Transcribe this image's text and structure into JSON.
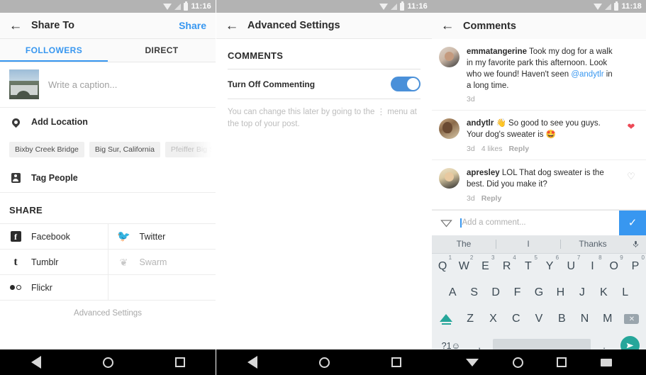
{
  "screen1": {
    "statusbar": {
      "time": "11:16",
      "icons": [
        "wifi-icon",
        "signal-icon",
        "battery-icon"
      ]
    },
    "appbar": {
      "back": "back-arrow-icon",
      "title": "Share To",
      "action": "Share"
    },
    "tabs": [
      {
        "label": "FOLLOWERS",
        "active": true
      },
      {
        "label": "DIRECT",
        "active": false
      }
    ],
    "caption": {
      "placeholder": "Write a caption...",
      "thumbnail": "post-thumbnail"
    },
    "add_location": {
      "label": "Add Location",
      "icon": "location-pin-icon"
    },
    "location_chips": [
      {
        "label": "Bixby Creek Bridge",
        "faded": false
      },
      {
        "label": "Big Sur, California",
        "faded": false
      },
      {
        "label": "Pfeiffer Big Sur State Par",
        "faded": true
      }
    ],
    "tag_people": {
      "label": "Tag People",
      "icon": "tag-people-icon"
    },
    "share_section": {
      "heading": "SHARE",
      "items": [
        {
          "label": "Facebook",
          "icon": "facebook-icon",
          "dim": false
        },
        {
          "label": "Twitter",
          "icon": "twitter-icon",
          "dim": false
        },
        {
          "label": "Tumblr",
          "icon": "tumblr-icon",
          "dim": false
        },
        {
          "label": "Swarm",
          "icon": "swarm-icon",
          "dim": true
        },
        {
          "label": "Flickr",
          "icon": "flickr-icon",
          "dim": false
        }
      ]
    },
    "advanced_settings_link": "Advanced Settings",
    "navbar": {
      "back": "nav-back-icon",
      "home": "nav-home-icon",
      "recent": "nav-recent-icon"
    },
    "colors": {
      "accent": "#3897f0",
      "appbar_bg": "#fafafa",
      "statusbar_bg": "#b3b3b3"
    }
  },
  "screen2": {
    "statusbar": {
      "time": "11:16"
    },
    "appbar": {
      "back": "back-arrow-icon",
      "title": "Advanced Settings"
    },
    "section_heading": "COMMENTS",
    "toggle": {
      "label": "Turn Off Commenting",
      "on": true,
      "color": "#4a90d9"
    },
    "hint_part1": "You can change this later by going to the",
    "hint_dots": "⋮",
    "hint_part2": "menu at the top of your post.",
    "navbar": {
      "back": "nav-back-icon",
      "home": "nav-home-icon",
      "recent": "nav-recent-icon"
    }
  },
  "screen3": {
    "statusbar": {
      "time": "11:18"
    },
    "appbar": {
      "back": "back-arrow-icon",
      "title": "Comments"
    },
    "comments": [
      {
        "avatar": "avatar-emmatangerine",
        "username": "emmatangerine",
        "text_before": " Took my dog for a walk in my favorite park this afternoon. Look who we found! Haven't seen ",
        "mention": "@andytlr",
        "text_after": " in a long time.",
        "time": "3d",
        "likes": "",
        "reply": "",
        "liked": false,
        "show_heart": false
      },
      {
        "avatar": "avatar-andytlr",
        "username": "andytlr",
        "text_before": " 👋 So good to see you guys. Your dog's sweater is 🤩",
        "mention": "",
        "text_after": "",
        "time": "3d",
        "likes": "4 likes",
        "reply": "Reply",
        "liked": true,
        "show_heart": true
      },
      {
        "avatar": "avatar-apresley",
        "username": "apresley",
        "text_before": " LOL That dog sweater is the best. Did you make it?",
        "mention": "",
        "text_after": "",
        "time": "3d",
        "likes": "",
        "reply": "Reply",
        "liked": false,
        "show_heart": true
      }
    ],
    "comment_input": {
      "icon": "send-outline-icon",
      "placeholder": "Add a comment...",
      "value": "",
      "submit_icon": "checkmark-icon",
      "submit_color": "#3897f0"
    },
    "keyboard": {
      "suggestions": [
        "The",
        "I",
        "Thanks"
      ],
      "mic": "microphone-icon",
      "row1": [
        {
          "key": "Q",
          "num": "1"
        },
        {
          "key": "W",
          "num": "2"
        },
        {
          "key": "E",
          "num": "3"
        },
        {
          "key": "R",
          "num": "4"
        },
        {
          "key": "T",
          "num": "5"
        },
        {
          "key": "Y",
          "num": "6"
        },
        {
          "key": "U",
          "num": "7"
        },
        {
          "key": "I",
          "num": "8"
        },
        {
          "key": "O",
          "num": "9"
        },
        {
          "key": "P",
          "num": "0"
        }
      ],
      "row2": [
        "A",
        "S",
        "D",
        "F",
        "G",
        "H",
        "J",
        "K",
        "L"
      ],
      "row3": [
        "Z",
        "X",
        "C",
        "V",
        "B",
        "N",
        "M"
      ],
      "shift": "shift-icon",
      "delete": "backspace-icon",
      "symbols": "?1☺",
      "comma": ",",
      "period": ".",
      "space": "",
      "send": "send-icon",
      "accent": "#26a69a"
    },
    "navbar": {
      "back": "nav-back-down-icon",
      "home": "nav-home-icon",
      "recent": "nav-recent-icon",
      "keyboard": "nav-keyboard-icon"
    }
  }
}
